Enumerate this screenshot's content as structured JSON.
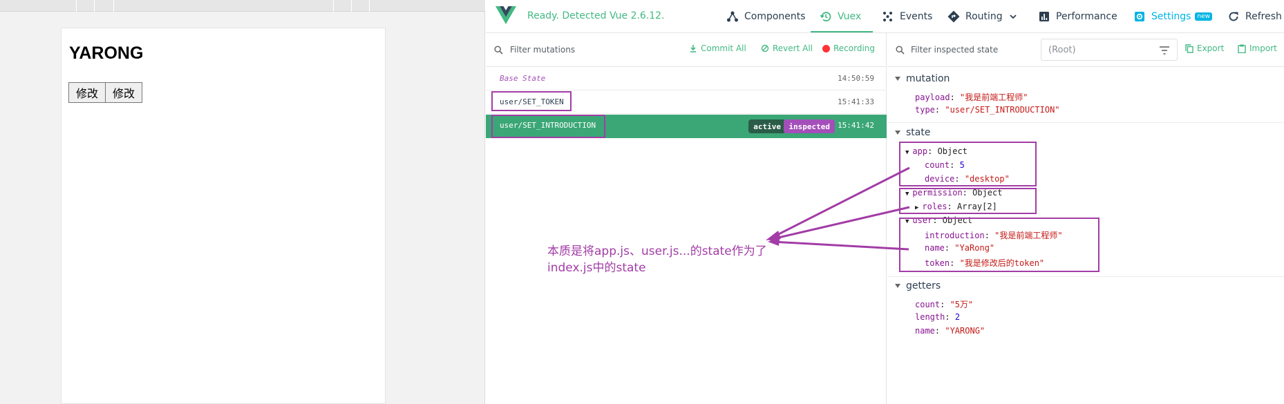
{
  "preview": {
    "title": "YARONG",
    "buttons": [
      "修改",
      "修改"
    ]
  },
  "devtools": {
    "status": "Ready. Detected Vue 2.6.12.",
    "nav": {
      "components": "Components",
      "vuex": "Vuex",
      "events": "Events",
      "routing": "Routing",
      "performance": "Performance",
      "settings": "Settings",
      "settings_badge": "new",
      "refresh": "Refresh"
    },
    "mutations": {
      "filter_placeholder": "Filter mutations",
      "commit_all": "Commit All",
      "revert_all": "Revert All",
      "recording": "Recording",
      "rows": [
        {
          "name": "Base State",
          "time": "14:50:59"
        },
        {
          "name": "user/SET_TOKEN",
          "time": "15:41:33"
        },
        {
          "name": "user/SET_INTRODUCTION",
          "time": "15:41:42",
          "tag_active": "active",
          "tag_inspected": "inspected"
        }
      ]
    },
    "inspector": {
      "filter_placeholder": "Filter inspected state",
      "root": "(Root)",
      "export": "Export",
      "import": "Import",
      "mutation": {
        "title": "mutation",
        "payload_key": "payload",
        "payload_value": "\"我是前端工程师\"",
        "type_key": "type",
        "type_value": "\"user/SET_INTRODUCTION\""
      },
      "state": {
        "title": "state",
        "app_key": "app",
        "app_type": "Object",
        "app_count_key": "count",
        "app_count_value": "5",
        "app_device_key": "device",
        "app_device_value": "\"desktop\"",
        "permission_key": "permission",
        "permission_type": "Object",
        "roles_key": "roles",
        "roles_value": "Array[2]",
        "user_key": "user",
        "user_type": "Object",
        "intro_key": "introduction",
        "intro_value": "\"我是前端工程师\"",
        "name_key": "name",
        "name_value": "\"YaRong\"",
        "token_key": "token",
        "token_value": "\"我是修改后的token\""
      },
      "getters": {
        "title": "getters",
        "count_key": "count",
        "count_value": "\"5万\"",
        "length_key": "length",
        "length_value": "2",
        "name_key": "name",
        "name_value": "\"YARONG\""
      }
    },
    "annotation": {
      "line1": "本质是将app.js、user.js...的state作为了",
      "line2": "index.js中的state"
    }
  },
  "colors": {
    "vue_green": "#42b983",
    "active_row": "#3ba776",
    "inspected_tag": "#a44fb9",
    "annotation": "#a23ca6"
  }
}
